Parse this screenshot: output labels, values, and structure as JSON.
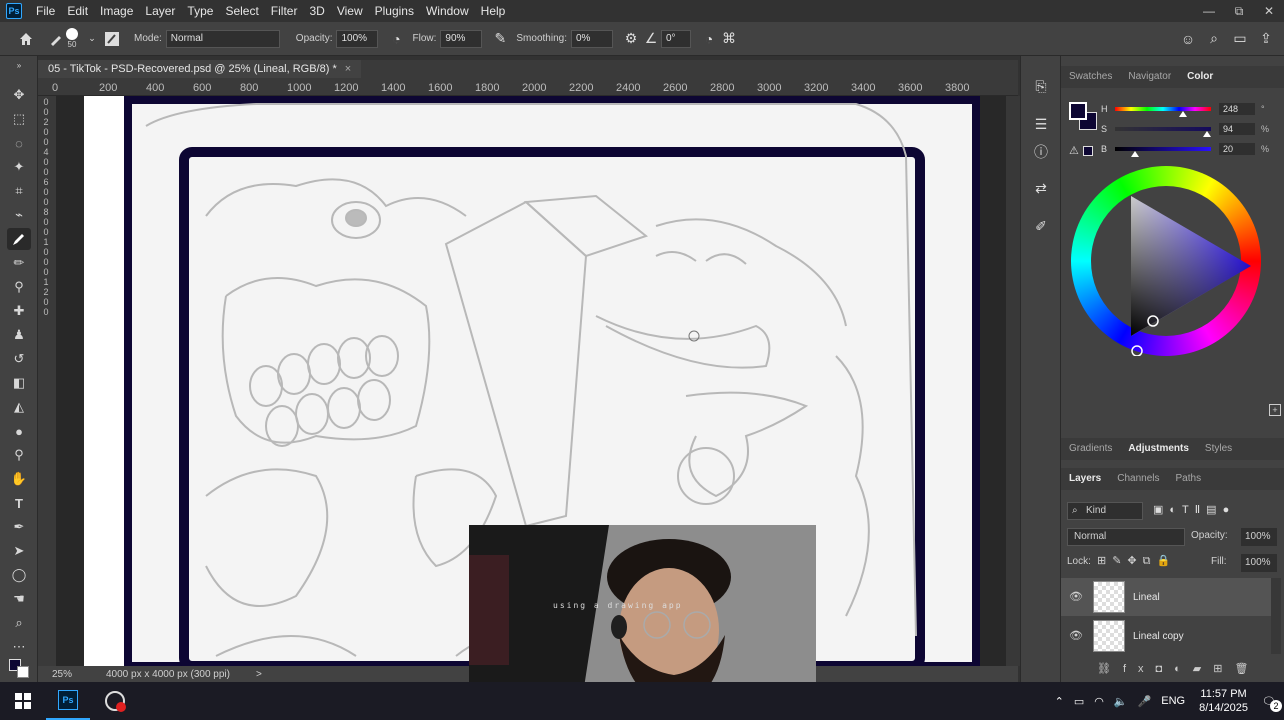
{
  "app": {
    "logo": "Ps"
  },
  "menu": [
    "File",
    "Edit",
    "Image",
    "Layer",
    "Type",
    "Select",
    "Filter",
    "3D",
    "View",
    "Plugins",
    "Window",
    "Help"
  ],
  "window_controls": {
    "minimize": "—",
    "restore": "⧉",
    "close": "✕"
  },
  "options": {
    "brush_size": "50",
    "mode_label": "Mode:",
    "mode_value": "Normal",
    "opacity_label": "Opacity:",
    "opacity_value": "100%",
    "flow_label": "Flow:",
    "flow_value": "90%",
    "smoothing_label": "Smoothing:",
    "smoothing_value": "0%",
    "angle_value": "0°"
  },
  "document": {
    "tab_title": "05 - TikTok - PSD-Recovered.psd @ 25% (Lineal, RGB/8) *",
    "tab_close": "×",
    "zoom": "25%",
    "doc_info": "4000 px x 4000 px (300 ppi)",
    "status_arrow": ">"
  },
  "ruler_top": [
    "0",
    "200",
    "400",
    "600",
    "800",
    "1000",
    "1200",
    "1400",
    "1600",
    "1800",
    "2000",
    "2200",
    "2400",
    "2600",
    "2800",
    "3000",
    "3200",
    "3400",
    "3600",
    "3800"
  ],
  "ruler_left": [
    "0",
    "0",
    "2",
    "0",
    "0",
    "4",
    "0",
    "0",
    "6",
    "0",
    "0",
    "8",
    "0",
    "0",
    "1",
    "0",
    "0",
    "0",
    "1",
    "2",
    "0",
    "0"
  ],
  "color_panel": {
    "tabs": [
      "Swatches",
      "Navigator",
      "Color"
    ],
    "active_tab": "Color",
    "h_label": "H",
    "h_value": "248",
    "h_unit": "°",
    "s_label": "S",
    "s_value": "94",
    "s_unit": "%",
    "b_label": "B",
    "b_value": "20",
    "b_unit": "%",
    "foreground": "#0d0633",
    "background": "#ffffff"
  },
  "adjustments_tabs": [
    "Gradients",
    "Adjustments",
    "Styles"
  ],
  "adjustments_active": "Adjustments",
  "layers_panel": {
    "tabs": [
      "Layers",
      "Channels",
      "Paths"
    ],
    "active_tab": "Layers",
    "filter_kind": "Kind",
    "blend_mode": "Normal",
    "opacity_label": "Opacity:",
    "opacity_value": "100%",
    "lock_label": "Lock:",
    "fill_label": "Fill:",
    "fill_value": "100%",
    "layers": [
      {
        "name": "Lineal",
        "selected": true
      },
      {
        "name": "Lineal copy",
        "selected": false
      }
    ]
  },
  "webcam": {
    "overlay_text": "using a drawing app"
  },
  "taskbar": {
    "language": "ENG",
    "time": "11:57 PM",
    "date": "8/14/2025",
    "notifications": "2"
  },
  "colors": {
    "accent": "#31a8ff",
    "ink": "#0d0633"
  }
}
